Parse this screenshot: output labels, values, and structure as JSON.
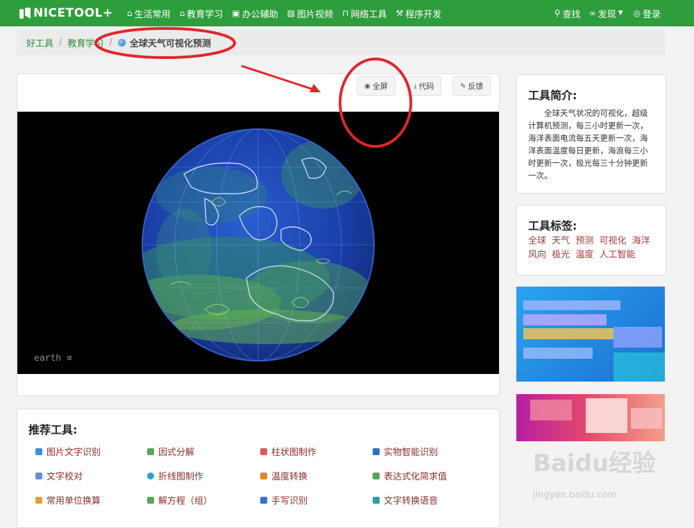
{
  "nav": {
    "logo": "NICETOOL+",
    "items": [
      {
        "label": "生活常用",
        "icon": "home-icon"
      },
      {
        "label": "教育学习",
        "icon": "graduation-cap-icon"
      },
      {
        "label": "办公辅助",
        "icon": "calendar-icon"
      },
      {
        "label": "图片视频",
        "icon": "image-icon"
      },
      {
        "label": "网络工具",
        "icon": "network-icon"
      },
      {
        "label": "程序开发",
        "icon": "wrench-icon"
      }
    ],
    "search": "查找",
    "discover": "发现",
    "login": "登录"
  },
  "breadcrumb": {
    "home": "好工具",
    "category": "教育学习",
    "current": "全球天气可视化预测"
  },
  "toolbar": {
    "fullscreen": "全屏",
    "code": "代码",
    "feedback": "反馈"
  },
  "viewer": {
    "label": "earth ≡"
  },
  "recommend": {
    "title": "推荐工具:",
    "items": [
      "图片文字识别",
      "因式分解",
      "柱状图制作",
      "实物智能识别",
      "文字校对",
      "折线图制作",
      "温度转换",
      "表达式化简求值",
      "常用单位换算",
      "解方程（组）",
      "手写识别",
      "文字转换语音"
    ]
  },
  "intro": {
    "title": "工具简介:",
    "text": "全球天气状况的可视化，超级计算机预测，每三小时更新一次，海洋表面电流每五天更新一次，海洋表面温度每日更新，海浪每三小时更新一次，极光每三十分钟更新一次。"
  },
  "tags": {
    "title": "工具标签:",
    "items": [
      "全球",
      "天气",
      "预测",
      "可视化",
      "海洋",
      "风向",
      "极光",
      "温度",
      "人工智能"
    ]
  },
  "watermark": {
    "brand": "Baidu经验",
    "url": "jingyan.baidu.com"
  }
}
